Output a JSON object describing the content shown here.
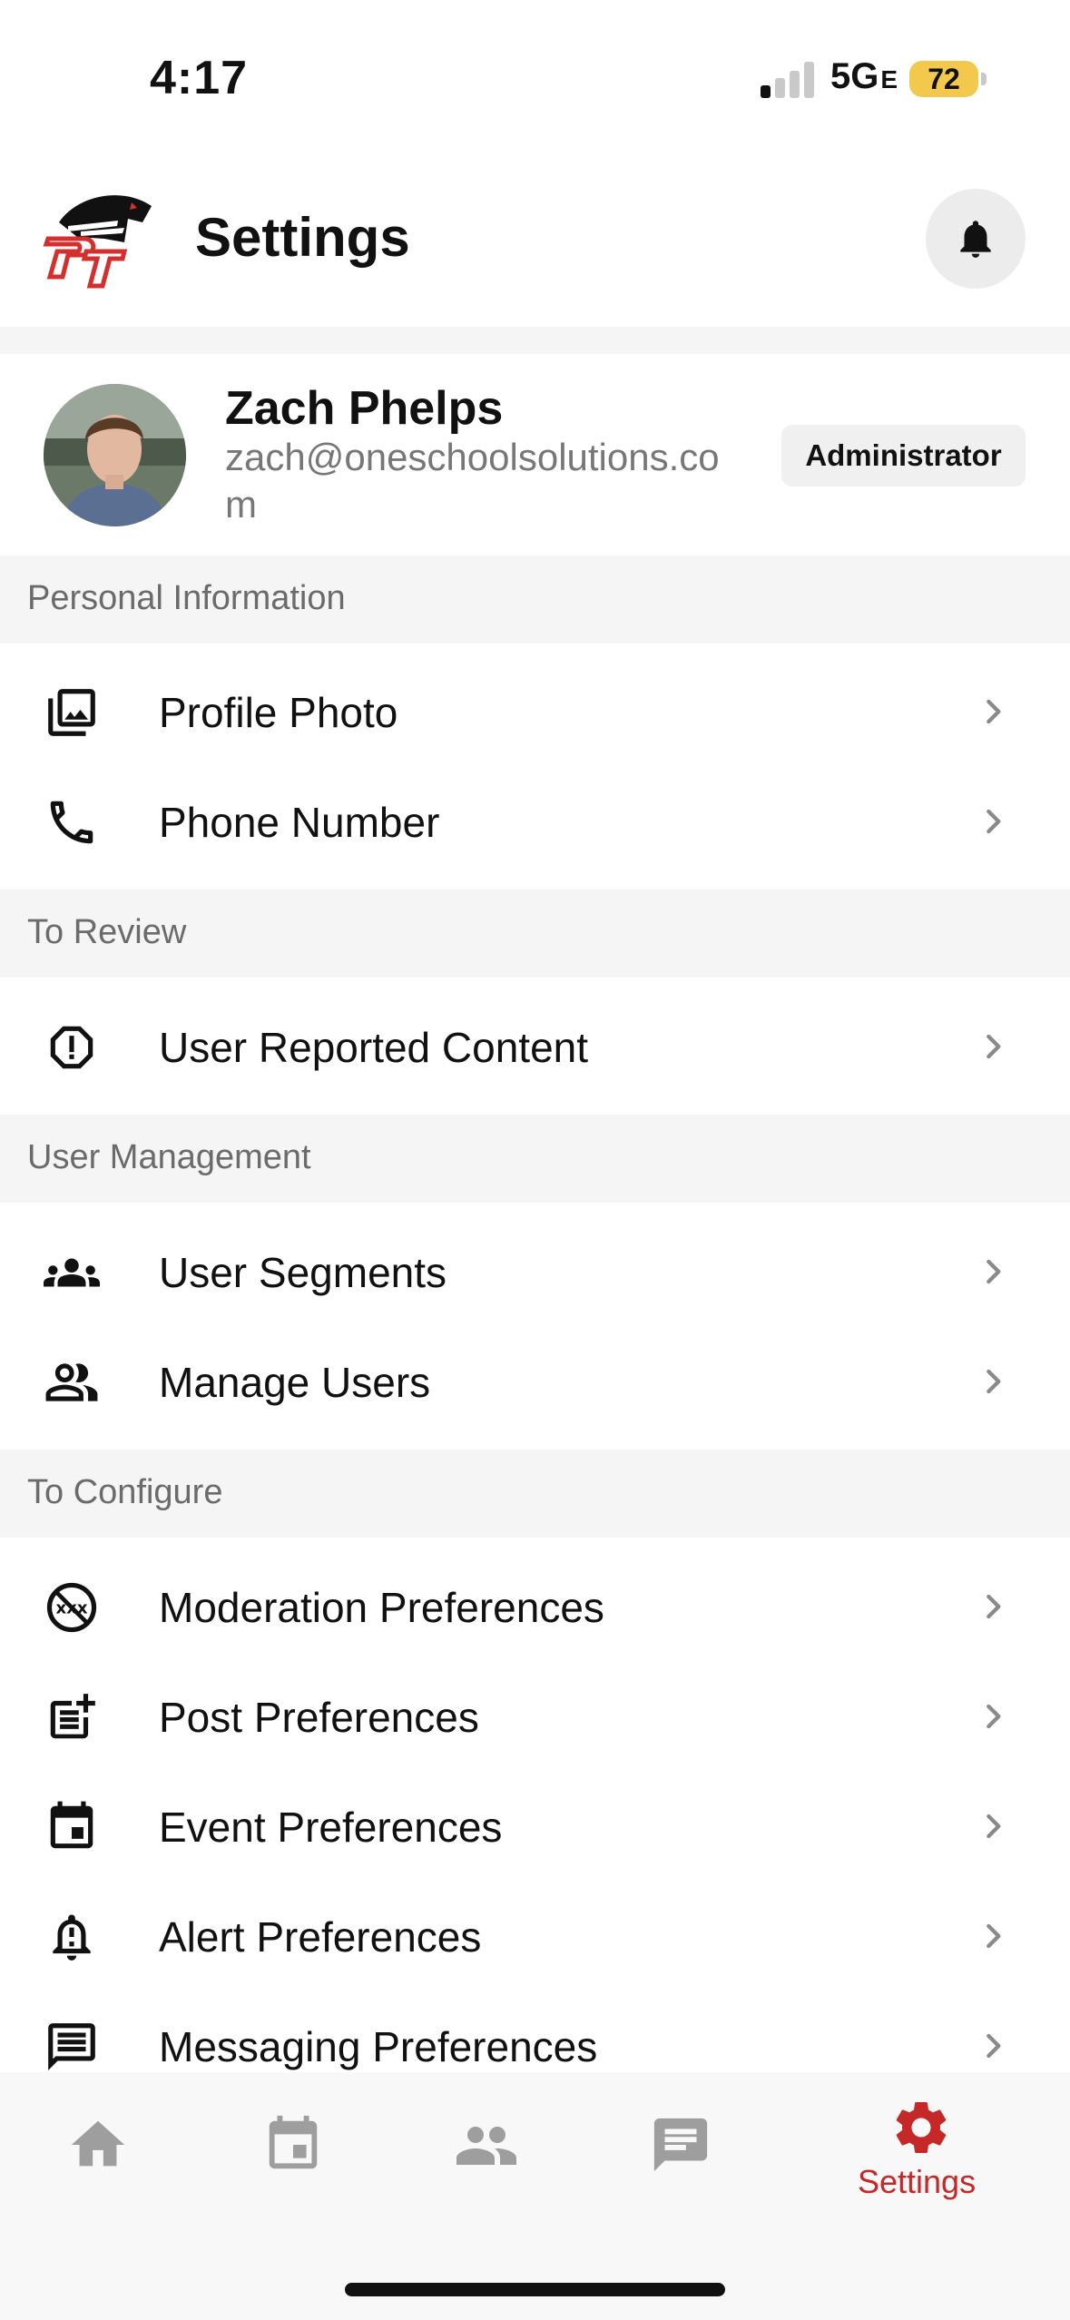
{
  "status_bar": {
    "time": "4:17",
    "network": "5G",
    "network_suffix": "E",
    "battery": "72",
    "battery_color": "#f2c94c"
  },
  "header": {
    "title": "Settings",
    "logo_icon": "panther-pt-logo",
    "bell_icon": "bell-icon"
  },
  "profile": {
    "name": "Zach Phelps",
    "email": "zach@oneschoolsolutions.com",
    "role": "Administrator"
  },
  "sections": {
    "personal": {
      "title": "Personal Information",
      "items": [
        {
          "label": "Profile Photo",
          "icon": "photo-library-icon"
        },
        {
          "label": "Phone Number",
          "icon": "phone-icon"
        }
      ]
    },
    "review": {
      "title": "To Review",
      "items": [
        {
          "label": "User Reported Content",
          "icon": "report-icon"
        }
      ]
    },
    "users": {
      "title": "User Management",
      "items": [
        {
          "label": "User Segments",
          "icon": "groups-icon"
        },
        {
          "label": "Manage Users",
          "icon": "people-icon"
        }
      ]
    },
    "configure": {
      "title": "To Configure",
      "items": [
        {
          "label": "Moderation Preferences",
          "icon": "moderation-icon"
        },
        {
          "label": "Post Preferences",
          "icon": "post-add-icon"
        },
        {
          "label": "Event Preferences",
          "icon": "event-icon"
        },
        {
          "label": "Alert Preferences",
          "icon": "alert-bell-icon"
        },
        {
          "label": "Messaging Preferences",
          "icon": "message-icon"
        }
      ]
    }
  },
  "bottom_nav": {
    "items": [
      {
        "icon": "home-icon"
      },
      {
        "icon": "calendar-icon"
      },
      {
        "icon": "people-icon"
      },
      {
        "icon": "message-icon"
      },
      {
        "icon": "settings-gear-icon",
        "label": "Settings",
        "active": true
      }
    ],
    "active_color": "#c62828",
    "inactive_color": "#9e9e9e"
  }
}
